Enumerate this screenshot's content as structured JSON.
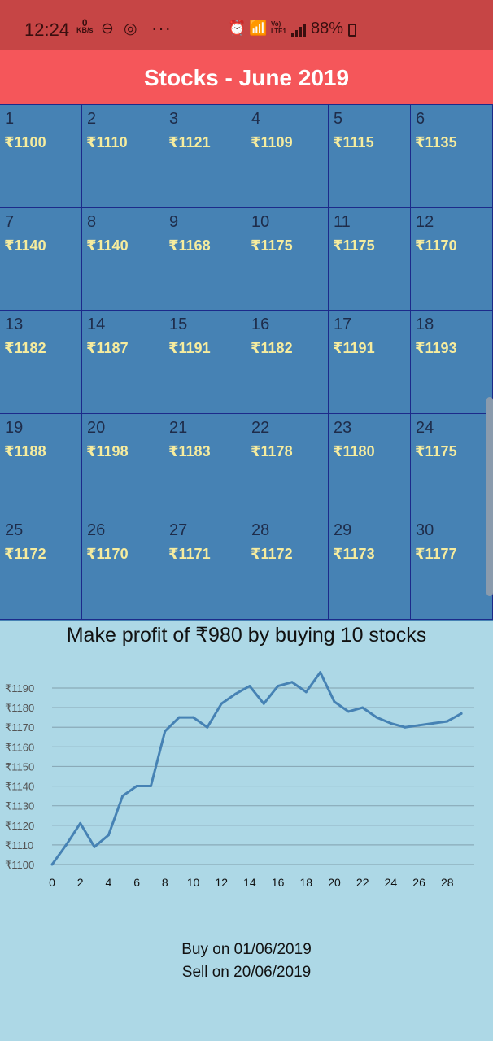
{
  "status_bar": {
    "time": "12:24",
    "net_speed": "0",
    "net_unit": "KB/s",
    "lte_label": "Vo) LTE1",
    "battery": "88%"
  },
  "app_bar": {
    "title": "Stocks - June 2019"
  },
  "calendar": {
    "currency": "₹",
    "days": [
      {
        "day": "1",
        "price": "₹1100"
      },
      {
        "day": "2",
        "price": "₹1110"
      },
      {
        "day": "3",
        "price": "₹1121"
      },
      {
        "day": "4",
        "price": "₹1109"
      },
      {
        "day": "5",
        "price": "₹1115"
      },
      {
        "day": "6",
        "price": "₹1135"
      },
      {
        "day": "7",
        "price": "₹1140"
      },
      {
        "day": "8",
        "price": "₹1140"
      },
      {
        "day": "9",
        "price": "₹1168"
      },
      {
        "day": "10",
        "price": "₹1175"
      },
      {
        "day": "11",
        "price": "₹1175"
      },
      {
        "day": "12",
        "price": "₹1170"
      },
      {
        "day": "13",
        "price": "₹1182"
      },
      {
        "day": "14",
        "price": "₹1187"
      },
      {
        "day": "15",
        "price": "₹1191"
      },
      {
        "day": "16",
        "price": "₹1182"
      },
      {
        "day": "17",
        "price": "₹1191"
      },
      {
        "day": "18",
        "price": "₹1193"
      },
      {
        "day": "19",
        "price": "₹1188"
      },
      {
        "day": "20",
        "price": "₹1198"
      },
      {
        "day": "21",
        "price": "₹1183"
      },
      {
        "day": "22",
        "price": "₹1178"
      },
      {
        "day": "23",
        "price": "₹1180"
      },
      {
        "day": "24",
        "price": "₹1175"
      },
      {
        "day": "25",
        "price": "₹1172"
      },
      {
        "day": "26",
        "price": "₹1170"
      },
      {
        "day": "27",
        "price": "₹1171"
      },
      {
        "day": "28",
        "price": "₹1172"
      },
      {
        "day": "29",
        "price": "₹1173"
      },
      {
        "day": "30",
        "price": "₹1177"
      }
    ]
  },
  "summary": {
    "profit_text": "Make profit of ₹980 by buying 10 stocks"
  },
  "chart_data": {
    "type": "line",
    "x": [
      0,
      1,
      2,
      3,
      4,
      5,
      6,
      7,
      8,
      9,
      10,
      11,
      12,
      13,
      14,
      15,
      16,
      17,
      18,
      19,
      20,
      21,
      22,
      23,
      24,
      25,
      26,
      27,
      28,
      29
    ],
    "values": [
      1100,
      1110,
      1121,
      1109,
      1115,
      1135,
      1140,
      1140,
      1168,
      1175,
      1175,
      1170,
      1182,
      1187,
      1191,
      1182,
      1191,
      1193,
      1188,
      1198,
      1183,
      1178,
      1180,
      1175,
      1172,
      1170,
      1171,
      1172,
      1173,
      1177
    ],
    "x_ticks": [
      "0",
      "2",
      "4",
      "6",
      "8",
      "10",
      "12",
      "14",
      "16",
      "18",
      "20",
      "22",
      "24",
      "26",
      "28"
    ],
    "y_ticks": [
      "₹1100",
      "₹1110",
      "₹1120",
      "₹1130",
      "₹1140",
      "₹1150",
      "₹1160",
      "₹1170",
      "₹1180",
      "₹1190"
    ],
    "ylim": [
      1100,
      1190
    ],
    "xlim": [
      0,
      29
    ],
    "grid": true,
    "line_color": "#4682b4"
  },
  "trade": {
    "buy": "Buy on 01/06/2019",
    "sell": "Sell on 20/06/2019"
  }
}
